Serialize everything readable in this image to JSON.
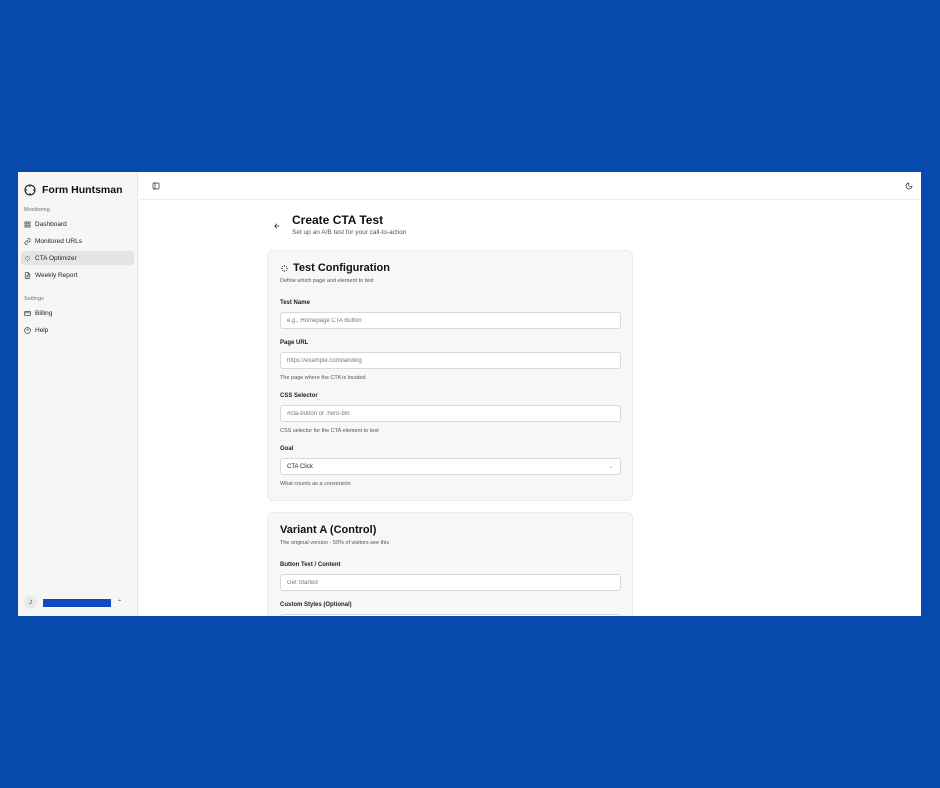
{
  "app": {
    "name": "Form Huntsman"
  },
  "sidebar": {
    "sections": [
      {
        "label": "Monitoring",
        "items": [
          {
            "label": "Dashboard",
            "icon": "grid-icon"
          },
          {
            "label": "Monitored URLs",
            "icon": "link-icon"
          },
          {
            "label": "CTA Optimizer",
            "icon": "sparkle-icon",
            "active": true
          },
          {
            "label": "Weekly Report",
            "icon": "file-icon"
          }
        ]
      },
      {
        "label": "Settings",
        "items": [
          {
            "label": "Billing",
            "icon": "credit-card-icon"
          },
          {
            "label": "Help",
            "icon": "help-circle-icon"
          }
        ]
      }
    ],
    "user": {
      "initial": "J"
    }
  },
  "page": {
    "title": "Create CTA Test",
    "subtitle": "Set up an A/B test for your call-to-action"
  },
  "config_card": {
    "title": "Test Configuration",
    "description": "Define which page and element to test",
    "test_name": {
      "label": "Test Name",
      "placeholder": "e.g., Homepage CTA Button"
    },
    "page_url": {
      "label": "Page URL",
      "placeholder": "https://example.com/landing",
      "help": "The page where the CTA is located"
    },
    "css_selector": {
      "label": "CSS Selector",
      "placeholder": "#cta-button or .hero-btn",
      "help": "CSS selector for the CTA element to test"
    },
    "goal": {
      "label": "Goal",
      "value": "CTA Click",
      "help": "What counts as a conversion"
    }
  },
  "variant_a": {
    "title": "Variant A (Control)",
    "description": "The original version - 50% of visitors see this",
    "button_text": {
      "label": "Button Text / Content",
      "placeholder": "Get Started"
    },
    "custom_styles": {
      "label": "Custom Styles (Optional)"
    }
  },
  "colors": {
    "background": "#0749ad",
    "active_nav": "#e4e4e6",
    "card": "#f7f7f8"
  }
}
